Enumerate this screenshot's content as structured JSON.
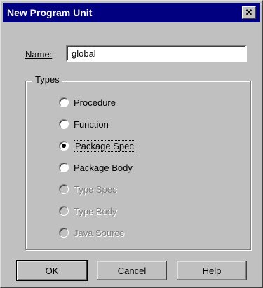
{
  "dialog": {
    "title": "New Program Unit",
    "close_label": "✕"
  },
  "name_field": {
    "label": "Name:",
    "value": "global"
  },
  "types_group": {
    "label": "Types",
    "options": [
      {
        "label": "Procedure",
        "selected": false,
        "enabled": true
      },
      {
        "label": "Function",
        "selected": false,
        "enabled": true
      },
      {
        "label": "Package Spec",
        "selected": true,
        "enabled": true
      },
      {
        "label": "Package Body",
        "selected": false,
        "enabled": true
      },
      {
        "label": "Type Spec",
        "selected": false,
        "enabled": false
      },
      {
        "label": "Type Body",
        "selected": false,
        "enabled": false
      },
      {
        "label": "Java Source",
        "selected": false,
        "enabled": false
      }
    ]
  },
  "buttons": {
    "ok": "OK",
    "cancel": "Cancel",
    "help": "Help"
  }
}
